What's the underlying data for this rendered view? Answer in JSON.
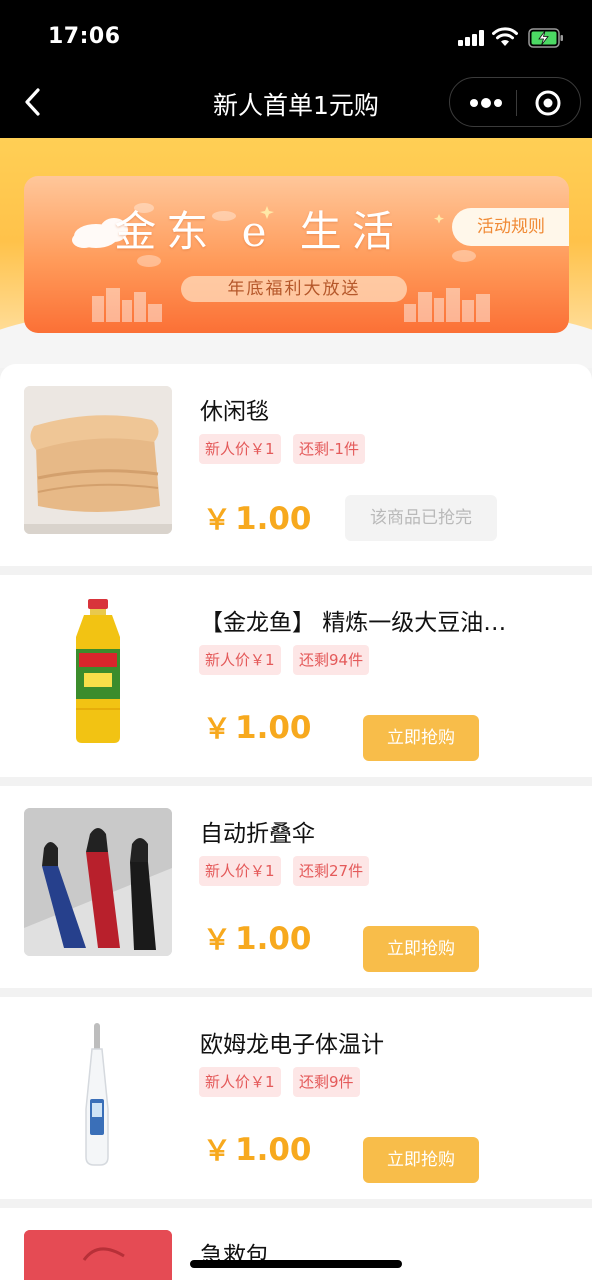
{
  "status_bar": {
    "time": "17:06",
    "icons": [
      "signal-icon",
      "wifi-icon",
      "battery-charging-icon"
    ]
  },
  "nav": {
    "title": "新人首单1元购",
    "icons": [
      "back-chevron-icon",
      "more-dots-icon",
      "close-target-icon"
    ]
  },
  "banner": {
    "title": "金东 e 生活",
    "subtitle": "年底福利大放送",
    "rules_label": "活动规则"
  },
  "colors": {
    "accent": "#f8bd4a",
    "price": "#f7a91e",
    "tag_bg": "#fde6e6",
    "tag_text": "#e45a5a",
    "banner_orange": "#fb7036"
  },
  "products": [
    {
      "name": "休闲毯",
      "tag_price": "新人价￥1",
      "tag_stock": "还剩-1件",
      "currency": "￥",
      "price": "1.00",
      "action": "该商品已抢完",
      "status": "sold_out",
      "image": "blanket"
    },
    {
      "name": "【金龙鱼】 精炼一级大豆油…",
      "tag_price": "新人价￥1",
      "tag_stock": "还剩94件",
      "currency": "￥",
      "price": "1.00",
      "action": "立即抢购",
      "status": "available",
      "image": "oil-bottle"
    },
    {
      "name": "自动折叠伞",
      "tag_price": "新人价￥1",
      "tag_stock": "还剩27件",
      "currency": "￥",
      "price": "1.00",
      "action": "立即抢购",
      "status": "available",
      "image": "umbrellas"
    },
    {
      "name": "欧姆龙电子体温计",
      "tag_price": "新人价￥1",
      "tag_stock": "还剩9件",
      "currency": "￥",
      "price": "1.00",
      "action": "立即抢购",
      "status": "available",
      "image": "thermometer"
    },
    {
      "name": "急救包",
      "image": "first-aid-bag"
    }
  ]
}
